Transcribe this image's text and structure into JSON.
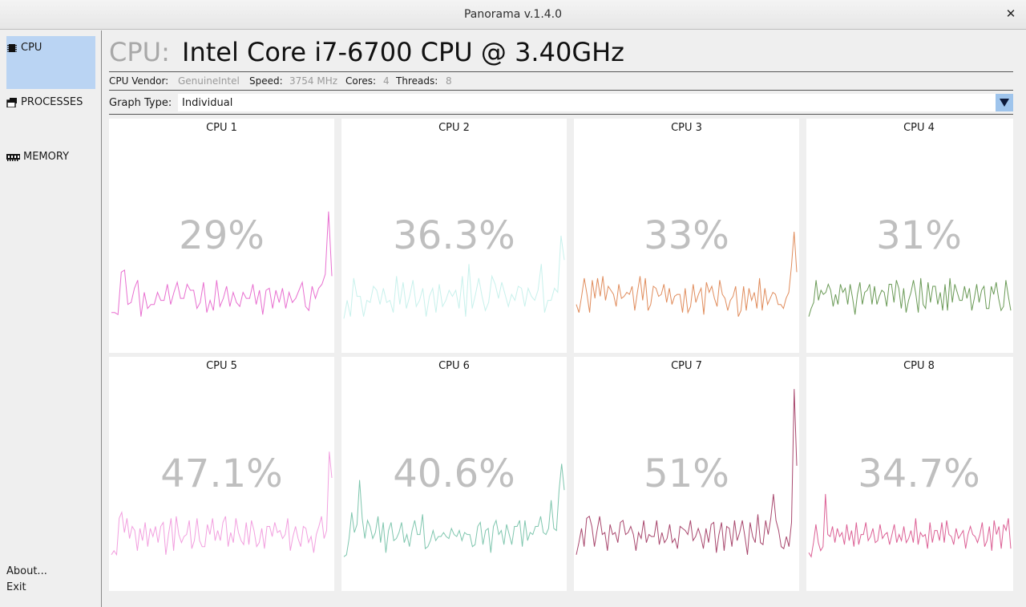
{
  "window": {
    "title": "Panorama v.1.4.0"
  },
  "sidebar": {
    "items": [
      {
        "label": "CPU",
        "icon": "chip-icon",
        "selected": true
      },
      {
        "label": "PROCESSES",
        "icon": "stacked-windows-icon",
        "selected": false
      },
      {
        "label": "MEMORY",
        "icon": "memory-module-icon",
        "selected": false
      }
    ],
    "footer": {
      "about": "About...",
      "exit": "Exit"
    }
  },
  "header": {
    "label": "CPU:",
    "model": "Intel Core i7-6700 CPU @ 3.40GHz"
  },
  "specs": {
    "vendor_label": "CPU Vendor:",
    "vendor": "GenuineIntel",
    "speed_label": "Speed:",
    "speed": "3754 MHz",
    "cores_label": "Cores:",
    "cores": "4",
    "threads_label": "Threads:",
    "threads": "8"
  },
  "graph_type": {
    "label": "Graph Type:",
    "value": "Individual"
  },
  "cpus": [
    {
      "name": "CPU 1",
      "usage": "29%",
      "color": "#e86fd0",
      "history": [
        0.12,
        0.12,
        0.11,
        0.32,
        0.33,
        0.16,
        0.17,
        0.24,
        0.28,
        0.1,
        0.22,
        0.14,
        0.16,
        0.16,
        0.22,
        0.18,
        0.18,
        0.26,
        0.16,
        0.22,
        0.27,
        0.19,
        0.19,
        0.26,
        0.23,
        0.23,
        0.14,
        0.17,
        0.27,
        0.12,
        0.18,
        0.13,
        0.28,
        0.15,
        0.19,
        0.25,
        0.15,
        0.22,
        0.17,
        0.15,
        0.22,
        0.19,
        0.19,
        0.26,
        0.16,
        0.23,
        0.11,
        0.23,
        0.24,
        0.14,
        0.23,
        0.17,
        0.24,
        0.14,
        0.22,
        0.17,
        0.19,
        0.23,
        0.27,
        0.15,
        0.13,
        0.25,
        0.19,
        0.24,
        0.26,
        0.31,
        0.62,
        0.3
      ]
    },
    {
      "name": "CPU 2",
      "usage": "36.3%",
      "color": "#c8f1ec",
      "history": [
        0.09,
        0.18,
        0.1,
        0.29,
        0.2,
        0.2,
        0.1,
        0.18,
        0.17,
        0.25,
        0.23,
        0.16,
        0.24,
        0.17,
        0.18,
        0.12,
        0.3,
        0.16,
        0.27,
        0.14,
        0.2,
        0.28,
        0.15,
        0.18,
        0.24,
        0.1,
        0.2,
        0.24,
        0.12,
        0.26,
        0.15,
        0.18,
        0.23,
        0.2,
        0.23,
        0.14,
        0.3,
        0.1,
        0.36,
        0.14,
        0.21,
        0.29,
        0.2,
        0.13,
        0.17,
        0.3,
        0.26,
        0.19,
        0.27,
        0.21,
        0.15,
        0.21,
        0.18,
        0.25,
        0.24,
        0.15,
        0.24,
        0.2,
        0.18,
        0.23,
        0.36,
        0.12,
        0.18,
        0.18,
        0.24,
        0.22,
        0.5,
        0.38
      ]
    },
    {
      "name": "CPU 3",
      "usage": "33%",
      "color": "#e08c5c",
      "history": [
        0.16,
        0.12,
        0.2,
        0.29,
        0.21,
        0.12,
        0.28,
        0.19,
        0.29,
        0.2,
        0.3,
        0.18,
        0.25,
        0.23,
        0.21,
        0.15,
        0.26,
        0.19,
        0.2,
        0.22,
        0.21,
        0.25,
        0.13,
        0.22,
        0.3,
        0.18,
        0.29,
        0.13,
        0.16,
        0.25,
        0.24,
        0.2,
        0.21,
        0.26,
        0.17,
        0.24,
        0.16,
        0.2,
        0.21,
        0.21,
        0.12,
        0.24,
        0.12,
        0.15,
        0.26,
        0.17,
        0.21,
        0.24,
        0.11,
        0.27,
        0.22,
        0.25,
        0.19,
        0.15,
        0.28,
        0.21,
        0.19,
        0.13,
        0.18,
        0.2,
        0.25,
        0.1,
        0.13,
        0.25,
        0.13,
        0.24,
        0.18,
        0.22,
        0.14,
        0.29,
        0.13,
        0.24,
        0.16,
        0.19,
        0.22,
        0.21,
        0.16,
        0.16,
        0.14,
        0.19,
        0.22,
        0.35,
        0.52,
        0.32
      ]
    },
    {
      "name": "CPU 4",
      "usage": "31%",
      "color": "#6a9a56",
      "history": [
        0.1,
        0.14,
        0.17,
        0.28,
        0.18,
        0.23,
        0.21,
        0.22,
        0.26,
        0.23,
        0.15,
        0.21,
        0.16,
        0.26,
        0.22,
        0.24,
        0.16,
        0.26,
        0.19,
        0.11,
        0.21,
        0.27,
        0.16,
        0.22,
        0.23,
        0.26,
        0.16,
        0.25,
        0.16,
        0.2,
        0.23,
        0.22,
        0.15,
        0.26,
        0.26,
        0.17,
        0.28,
        0.24,
        0.14,
        0.24,
        0.12,
        0.18,
        0.22,
        0.28,
        0.21,
        0.12,
        0.29,
        0.16,
        0.14,
        0.27,
        0.17,
        0.25,
        0.25,
        0.16,
        0.22,
        0.13,
        0.26,
        0.13,
        0.29,
        0.17,
        0.26,
        0.22,
        0.18,
        0.18,
        0.25,
        0.19,
        0.24,
        0.13,
        0.19,
        0.26,
        0.17,
        0.23,
        0.25,
        0.14,
        0.14,
        0.25,
        0.21,
        0.27,
        0.19,
        0.13,
        0.15,
        0.28,
        0.2,
        0.13
      ]
    },
    {
      "name": "CPU 5",
      "usage": "47.1%",
      "color": "#f29fdf",
      "history": [
        0.1,
        0.12,
        0.1,
        0.28,
        0.31,
        0.21,
        0.28,
        0.18,
        0.24,
        0.22,
        0.12,
        0.23,
        0.17,
        0.26,
        0.14,
        0.23,
        0.19,
        0.24,
        0.16,
        0.24,
        0.26,
        0.1,
        0.2,
        0.28,
        0.12,
        0.29,
        0.2,
        0.16,
        0.19,
        0.2,
        0.27,
        0.13,
        0.17,
        0.28,
        0.17,
        0.14,
        0.14,
        0.25,
        0.2,
        0.28,
        0.17,
        0.22,
        0.17,
        0.26,
        0.29,
        0.14,
        0.21,
        0.16,
        0.28,
        0.21,
        0.17,
        0.15,
        0.26,
        0.15,
        0.27,
        0.22,
        0.14,
        0.16,
        0.23,
        0.13,
        0.24,
        0.24,
        0.19,
        0.26,
        0.21,
        0.22,
        0.18,
        0.2,
        0.28,
        0.12,
        0.19,
        0.24,
        0.18,
        0.14,
        0.24,
        0.23,
        0.16,
        0.19,
        0.11,
        0.2,
        0.24,
        0.29,
        0.18,
        0.22,
        0.61,
        0.48
      ]
    },
    {
      "name": "CPU 6",
      "usage": "40.6%",
      "color": "#7fc6ae",
      "history": [
        0.09,
        0.1,
        0.18,
        0.31,
        0.21,
        0.25,
        0.47,
        0.28,
        0.18,
        0.27,
        0.24,
        0.18,
        0.21,
        0.29,
        0.16,
        0.26,
        0.11,
        0.22,
        0.26,
        0.17,
        0.18,
        0.21,
        0.26,
        0.16,
        0.2,
        0.14,
        0.22,
        0.27,
        0.2,
        0.2,
        0.3,
        0.13,
        0.14,
        0.17,
        0.22,
        0.17,
        0.19,
        0.19,
        0.21,
        0.19,
        0.18,
        0.23,
        0.2,
        0.19,
        0.22,
        0.17,
        0.21,
        0.2,
        0.2,
        0.14,
        0.15,
        0.24,
        0.26,
        0.15,
        0.22,
        0.23,
        0.11,
        0.24,
        0.27,
        0.2,
        0.22,
        0.15,
        0.25,
        0.2,
        0.15,
        0.24,
        0.24,
        0.27,
        0.14,
        0.27,
        0.17,
        0.21,
        0.2,
        0.24,
        0.24,
        0.29,
        0.21,
        0.2,
        0.23,
        0.37,
        0.23,
        0.22,
        0.42,
        0.55,
        0.42
      ]
    },
    {
      "name": "CPU 7",
      "usage": "51%",
      "color": "#a8476d",
      "history": [
        0.1,
        0.16,
        0.23,
        0.14,
        0.28,
        0.29,
        0.24,
        0.14,
        0.22,
        0.29,
        0.2,
        0.21,
        0.12,
        0.25,
        0.2,
        0.21,
        0.16,
        0.26,
        0.27,
        0.2,
        0.21,
        0.24,
        0.2,
        0.12,
        0.21,
        0.18,
        0.27,
        0.16,
        0.2,
        0.19,
        0.19,
        0.27,
        0.15,
        0.21,
        0.16,
        0.18,
        0.25,
        0.16,
        0.18,
        0.13,
        0.24,
        0.23,
        0.22,
        0.2,
        0.27,
        0.17,
        0.19,
        0.23,
        0.19,
        0.13,
        0.23,
        0.16,
        0.25,
        0.26,
        0.11,
        0.2,
        0.26,
        0.12,
        0.24,
        0.23,
        0.14,
        0.27,
        0.17,
        0.21,
        0.27,
        0.19,
        0.1,
        0.26,
        0.19,
        0.16,
        0.3,
        0.16,
        0.15,
        0.27,
        0.2,
        0.28,
        0.4,
        0.27,
        0.22,
        0.14,
        0.13,
        0.19,
        0.14,
        0.26,
        0.92,
        0.54
      ]
    },
    {
      "name": "CPU 8",
      "usage": "34.7%",
      "color": "#dc6095",
      "history": [
        0.11,
        0.09,
        0.16,
        0.25,
        0.16,
        0.12,
        0.14,
        0.4,
        0.2,
        0.19,
        0.24,
        0.16,
        0.23,
        0.19,
        0.21,
        0.15,
        0.25,
        0.17,
        0.22,
        0.14,
        0.26,
        0.15,
        0.2,
        0.2,
        0.26,
        0.17,
        0.19,
        0.23,
        0.16,
        0.17,
        0.25,
        0.18,
        0.2,
        0.21,
        0.15,
        0.2,
        0.25,
        0.16,
        0.2,
        0.17,
        0.24,
        0.16,
        0.18,
        0.22,
        0.16,
        0.28,
        0.15,
        0.21,
        0.19,
        0.2,
        0.13,
        0.26,
        0.16,
        0.22,
        0.22,
        0.17,
        0.26,
        0.16,
        0.27,
        0.2,
        0.19,
        0.15,
        0.23,
        0.18,
        0.2,
        0.22,
        0.13,
        0.2,
        0.24,
        0.2,
        0.19,
        0.16,
        0.2,
        0.26,
        0.14,
        0.17,
        0.24,
        0.12,
        0.27,
        0.2,
        0.24,
        0.13,
        0.25,
        0.22,
        0.28,
        0.13
      ]
    }
  ]
}
